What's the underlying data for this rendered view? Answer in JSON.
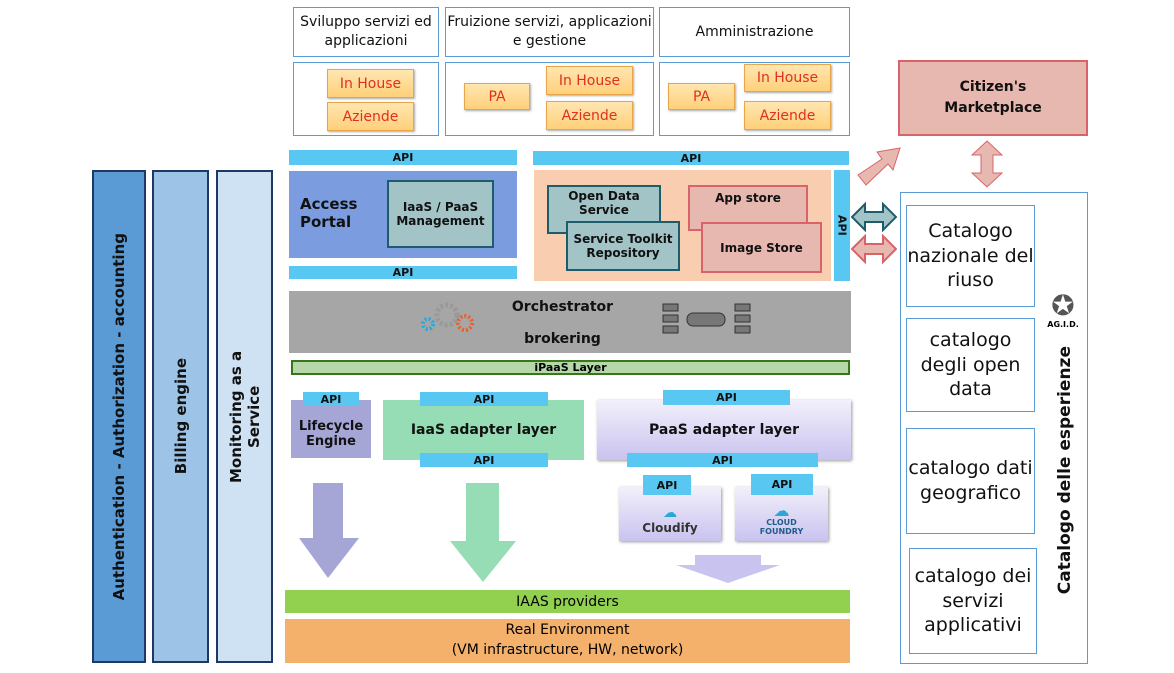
{
  "columns": [
    {
      "title": "Sviluppo servizi ed applicazioni",
      "buttons": [
        "In House",
        "Aziende"
      ]
    },
    {
      "title": "Fruizione servizi, applicazioni e gestione",
      "buttons": [
        "PA",
        "In House",
        "Aziende"
      ]
    },
    {
      "title": "Amministrazione",
      "buttons": [
        "PA",
        "In House",
        "Aziende"
      ]
    }
  ],
  "marketplace": "Citizen's Marketplace",
  "api": "API",
  "access_portal": "Access Portal",
  "iaas_paas_mgmt": "IaaS / PaaS Management",
  "open_data_service": "Open Data Service",
  "service_toolkit": "Service Toolkit Repository",
  "app_store": "App store",
  "image_store": "Image Store",
  "orchestrator": "Orchestrator",
  "brokering": "brokering",
  "ipaas": "iPaaS Layer",
  "left_bars": [
    "Authentication - Authorization - accounting",
    "Billing engine",
    "Monitoring as a Service"
  ],
  "lifecycle": "Lifecycle Engine",
  "iaas_adapter": "IaaS adapter layer",
  "paas_adapter": "PaaS adapter layer",
  "cloudify": "Cloudify",
  "cloud_foundry": "CLOUD FOUNDRY",
  "iaas_providers": "IAAS providers",
  "real_env": "Real Environment",
  "real_env_sub": "(VM infrastructure, HW, network)",
  "catalogs": [
    "Catalogo nazionale del riuso",
    "catalogo degli open data",
    "catalogo dati geografico",
    "catalogo dei servizi applicativi"
  ],
  "catalog_title": "Catalogo delle esperienze",
  "agid": "AG.I.D."
}
